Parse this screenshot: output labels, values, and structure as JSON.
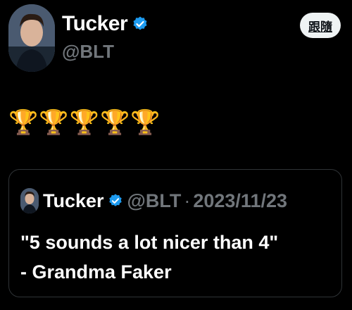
{
  "author": {
    "display_name": "Tucker",
    "handle": "@BLT",
    "verified": true
  },
  "follow_button": {
    "label": "跟隨"
  },
  "tweet": {
    "text": "🏆🏆🏆🏆🏆"
  },
  "quote": {
    "display_name": "Tucker",
    "handle": "@BLT",
    "separator": "·",
    "date": "2023/11/23",
    "text": "\"5 sounds a lot nicer than 4\"\n- Grandma Faker"
  },
  "colors": {
    "background": "#000000",
    "verified_badge": "#1d9bf0",
    "secondary_text": "#71767b",
    "border": "#2f3336",
    "button_bg": "#eff3f4"
  },
  "icons": {
    "verified": "verified-badge-icon",
    "avatar": "profile-avatar"
  }
}
